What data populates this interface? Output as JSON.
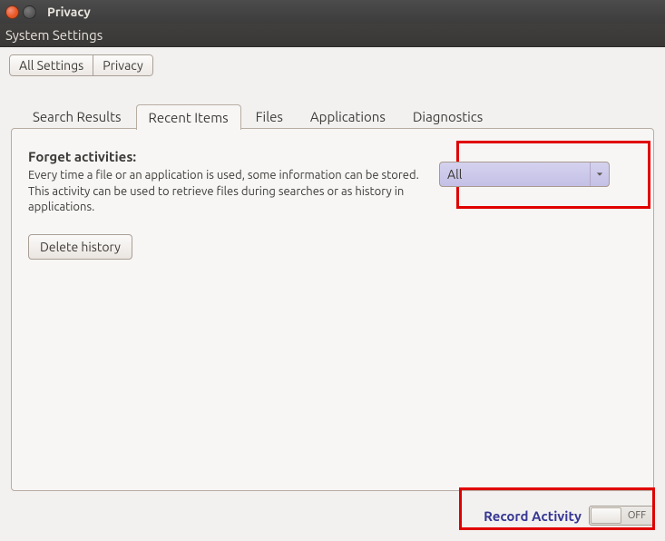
{
  "window": {
    "title": "Privacy",
    "subtitle": "System Settings"
  },
  "breadcrumb": {
    "all_settings": "All Settings",
    "current": "Privacy"
  },
  "tabs": {
    "search_results": "Search Results",
    "recent_items": "Recent Items",
    "files": "Files",
    "applications": "Applications",
    "diagnostics": "Diagnostics"
  },
  "panel": {
    "heading": "Forget activities:",
    "description": "Every time a file or an application is used, some information can be stored. This activity can be used to retrieve files during searches or as history in applications.",
    "delete_button": "Delete history",
    "dropdown_selected": "All"
  },
  "footer": {
    "record_activity_label": "Record Activity",
    "switch_state": "OFF"
  }
}
